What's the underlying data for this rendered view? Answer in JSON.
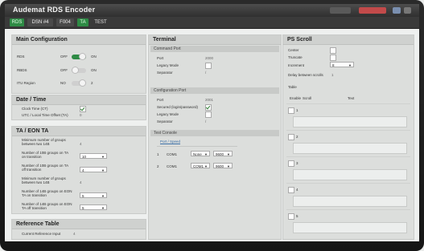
{
  "app": {
    "title": "Audemat RDS Encoder"
  },
  "tabs": [
    {
      "label": "RDS",
      "style": "green"
    },
    {
      "label": "DSN #4",
      "style": "dark"
    },
    {
      "label": "F004",
      "style": "dark"
    },
    {
      "label": "TA",
      "style": "green"
    },
    {
      "label": "TEST",
      "style": "plain"
    }
  ],
  "colors": {
    "accent_green": "#2e8b45",
    "toolbar_red": "#c24a4a",
    "header_dark": "#3a3a3a"
  },
  "main_config": {
    "title": "Main Configuration",
    "rows": [
      {
        "label": "RDS",
        "off": "OFF",
        "on": "ON",
        "state": true
      },
      {
        "label": "RBDS",
        "off": "OFF",
        "on": "ON",
        "state": false
      },
      {
        "label": "ITU Region",
        "off": "NO",
        "on": "2",
        "state": false
      }
    ]
  },
  "datetime": {
    "title": "Date / Time",
    "rows": [
      {
        "label": "Clock Time (CT)",
        "checked": true
      },
      {
        "label": "UTC / Local Time Offset (TA)",
        "value": "0"
      }
    ]
  },
  "ta_eon": {
    "title": "TA / EON TA",
    "rows": [
      {
        "label": "Minimum number of groups between two 14B",
        "value": "4"
      },
      {
        "label": "Number of 10B groups on TA on transition",
        "value": "10"
      },
      {
        "label": "Number of 10B groups on TA off transition",
        "value": "4"
      },
      {
        "label": "Minimum number of groups between two 14B",
        "value": "4"
      },
      {
        "label": "Number of 14B groups on EON TA on transition",
        "value": "5"
      },
      {
        "label": "Number of 14B groups on EON TA off transition",
        "value": "5"
      }
    ]
  },
  "reference": {
    "title": "Reference Table",
    "rows": [
      {
        "label": "Current Reference Input",
        "value": "4"
      }
    ]
  },
  "terminal": {
    "title": "Terminal",
    "command_port": {
      "title": "Command Port",
      "rows": [
        {
          "label": "Port",
          "value": "2000"
        },
        {
          "label": "Legacy Mode",
          "checked": false
        },
        {
          "label": "Separator",
          "value": "/"
        }
      ]
    },
    "config_port": {
      "title": "Configuration Port",
      "rows": [
        {
          "label": "Port",
          "value": "2001"
        },
        {
          "label": "Secured (login/password)",
          "checked": true
        },
        {
          "label": "Legacy Mode",
          "checked": false
        },
        {
          "label": "Separator",
          "value": "/"
        }
      ]
    },
    "console": {
      "title": "Test Console",
      "link": "Port / Speed",
      "rows": [
        {
          "num": "1",
          "port": "COM1",
          "mode": "None",
          "speed": "9600"
        },
        {
          "num": "2",
          "port": "COM1",
          "mode": "COM1",
          "speed": "9600"
        }
      ]
    }
  },
  "ps_scroll": {
    "title": "PS Scroll",
    "rows": [
      {
        "label": "Center",
        "checked": false
      },
      {
        "label": "Truncate",
        "checked": false
      },
      {
        "label": "Increment",
        "value": "8"
      },
      {
        "label": "Delay between scrolls",
        "value": "1"
      }
    ],
    "table": {
      "label": "Table",
      "columns": [
        "Enable",
        "Scroll",
        "Text"
      ],
      "rows": [
        "1",
        "2",
        "3",
        "4",
        "5"
      ]
    }
  }
}
